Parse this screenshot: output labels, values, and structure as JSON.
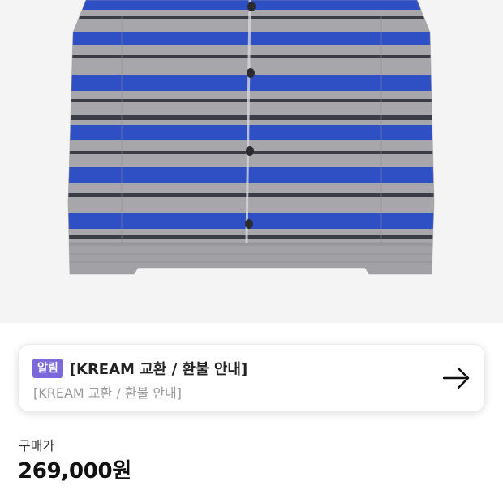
{
  "notice": {
    "badge": "알림",
    "title": "[KREAM 교환 / 환불 안내]",
    "subtitle": "[KREAM 교환 / 환불 안내]",
    "arrow_icon": "arrow-right-icon"
  },
  "price": {
    "label": "구매가",
    "value": "269,000원"
  },
  "colors": {
    "badge_bg": "#7b68d9",
    "stripe_blue": "#2f4fc4",
    "stripe_grey": "#a4a4a8",
    "stripe_dark": "#3b3d46"
  }
}
